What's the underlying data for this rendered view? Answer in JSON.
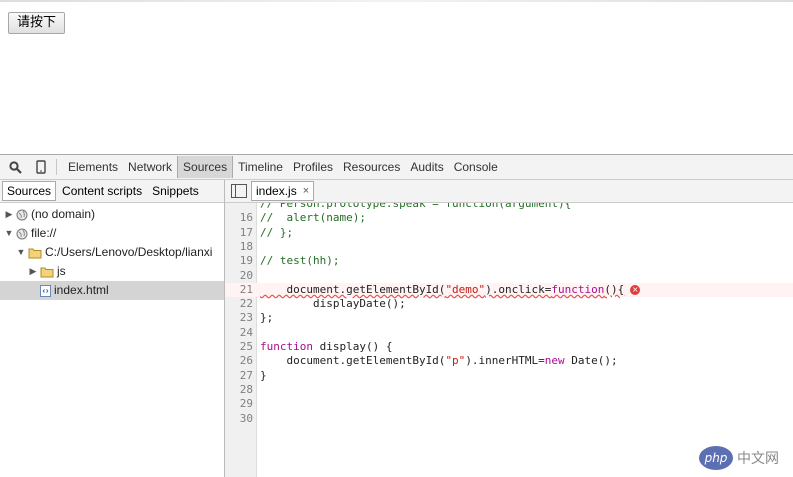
{
  "page": {
    "button_label": "请按下"
  },
  "toolbar": {
    "icons": [
      "search-icon",
      "device-mode-icon"
    ],
    "tabs": [
      {
        "label": "Elements",
        "active": false
      },
      {
        "label": "Network",
        "active": false
      },
      {
        "label": "Sources",
        "active": true
      },
      {
        "label": "Timeline",
        "active": false
      },
      {
        "label": "Profiles",
        "active": false
      },
      {
        "label": "Resources",
        "active": false
      },
      {
        "label": "Audits",
        "active": false
      },
      {
        "label": "Console",
        "active": false
      }
    ]
  },
  "navigator": {
    "tabs": [
      {
        "label": "Sources",
        "active": true
      },
      {
        "label": "Content scripts",
        "active": false
      },
      {
        "label": "Snippets",
        "active": false
      }
    ],
    "tree": [
      {
        "label": "(no domain)",
        "expanded": false,
        "icon": "globe-icon",
        "level": 0
      },
      {
        "label": "file://",
        "expanded": true,
        "icon": "globe-icon",
        "level": 0
      },
      {
        "label": "C:/Users/Lenovo/Desktop/lianxi",
        "expanded": true,
        "icon": "folder-icon",
        "level": 1
      },
      {
        "label": "js",
        "expanded": false,
        "icon": "folder-icon",
        "level": 2
      },
      {
        "label": "index.html",
        "expanded": null,
        "icon": "html-file-icon",
        "level": 2,
        "selected": true
      }
    ]
  },
  "editor": {
    "open_tab": "index.js",
    "close_symbol": "×",
    "lines": [
      {
        "n": "",
        "segs": [
          {
            "t": "c-comment",
            "v": "// Person.prototype.speak = function(argument){"
          }
        ]
      },
      {
        "n": "16",
        "segs": [
          {
            "t": "c-comment",
            "v": "//  alert(name);"
          }
        ]
      },
      {
        "n": "17",
        "segs": [
          {
            "t": "c-comment",
            "v": "// };"
          }
        ]
      },
      {
        "n": "18",
        "segs": []
      },
      {
        "n": "19",
        "segs": [
          {
            "t": "c-comment",
            "v": "// test(hh);"
          }
        ]
      },
      {
        "n": "20",
        "segs": []
      },
      {
        "n": "21",
        "error": true,
        "segs": [
          {
            "t": "",
            "v": "    document.getElementById("
          },
          {
            "t": "c-string",
            "v": "\"demo\""
          },
          {
            "t": "",
            "v": ").onclick="
          },
          {
            "t": "c-keyword",
            "v": "function"
          },
          {
            "t": "",
            "v": "(){"
          }
        ]
      },
      {
        "n": "22",
        "segs": [
          {
            "t": "",
            "v": "        displayDate();"
          }
        ]
      },
      {
        "n": "23",
        "segs": [
          {
            "t": "",
            "v": "};"
          }
        ]
      },
      {
        "n": "24",
        "segs": []
      },
      {
        "n": "25",
        "segs": [
          {
            "t": "c-keyword",
            "v": "function"
          },
          {
            "t": "",
            "v": " display() {"
          }
        ]
      },
      {
        "n": "26",
        "segs": [
          {
            "t": "",
            "v": "    document.getElementById("
          },
          {
            "t": "c-string",
            "v": "\"p\""
          },
          {
            "t": "",
            "v": ").innerHTML="
          },
          {
            "t": "c-keyword",
            "v": "new"
          },
          {
            "t": "",
            "v": " Date();"
          }
        ]
      },
      {
        "n": "27",
        "segs": [
          {
            "t": "",
            "v": "}"
          }
        ]
      },
      {
        "n": "28",
        "segs": []
      },
      {
        "n": "29",
        "segs": []
      },
      {
        "n": "30",
        "segs": []
      }
    ],
    "error_symbol": "×"
  },
  "watermark": {
    "oval_text": "php",
    "text": "中文网"
  }
}
